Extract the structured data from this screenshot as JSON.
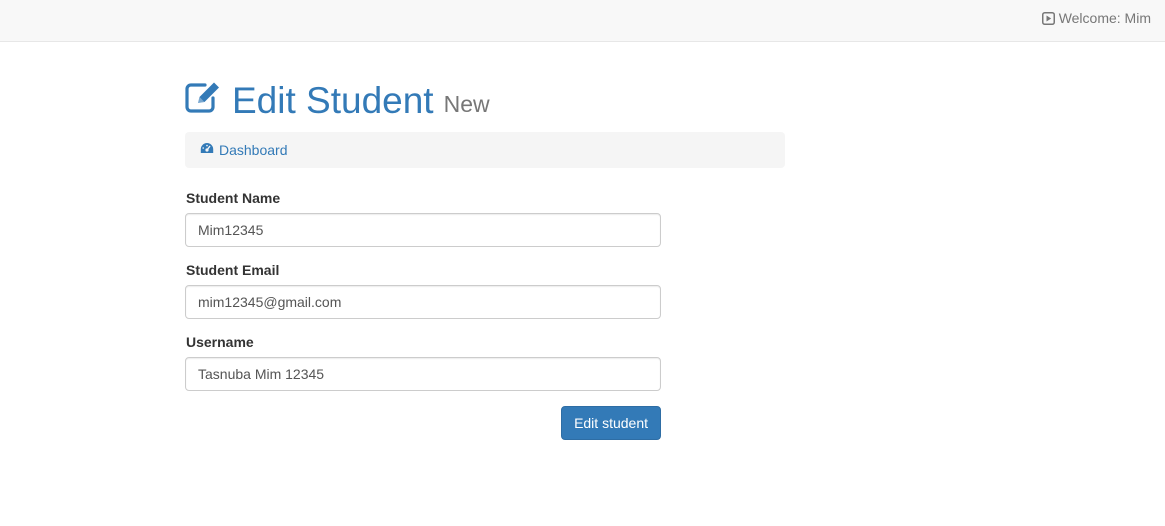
{
  "topbar": {
    "welcome_text": "Welcome: Mim",
    "icon": "play-square-icon"
  },
  "header": {
    "icon": "edit-square-icon",
    "title": "Edit Student",
    "subtitle": "New"
  },
  "breadcrumb": {
    "icon": "dashboard-icon",
    "label": "Dashboard"
  },
  "form": {
    "fields": [
      {
        "label": "Student Name",
        "value": "Mim12345"
      },
      {
        "label": "Student Email",
        "value": "mim12345@gmail.com"
      },
      {
        "label": "Username",
        "value": "Tasnuba Mim 12345"
      }
    ],
    "submit_label": "Edit student"
  },
  "colors": {
    "primary": "#337ab7",
    "navbar_bg": "#f8f8f8",
    "muted_text": "#777777"
  }
}
